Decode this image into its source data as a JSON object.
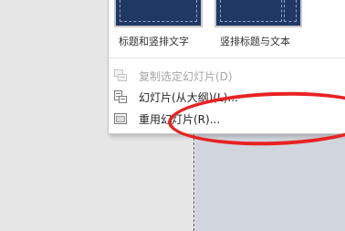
{
  "layouts": [
    {
      "label": "标题和竖排文字"
    },
    {
      "label": "竖排标题与文本"
    }
  ],
  "menu": {
    "items": [
      {
        "label": "复制选定幻灯片(D)",
        "icon": "duplicate-slide-icon",
        "enabled": false
      },
      {
        "label": "幻灯片(从大纲)(L)...",
        "icon": "slides-from-outline-icon",
        "enabled": true
      },
      {
        "label": "重用幻灯片(R)...",
        "icon": "reuse-slides-icon",
        "enabled": true
      }
    ]
  },
  "annotation": {
    "color": "#e82222"
  },
  "colors": {
    "thumb_bg": "#1f3864",
    "slide_bg": "#d1d5dd"
  }
}
